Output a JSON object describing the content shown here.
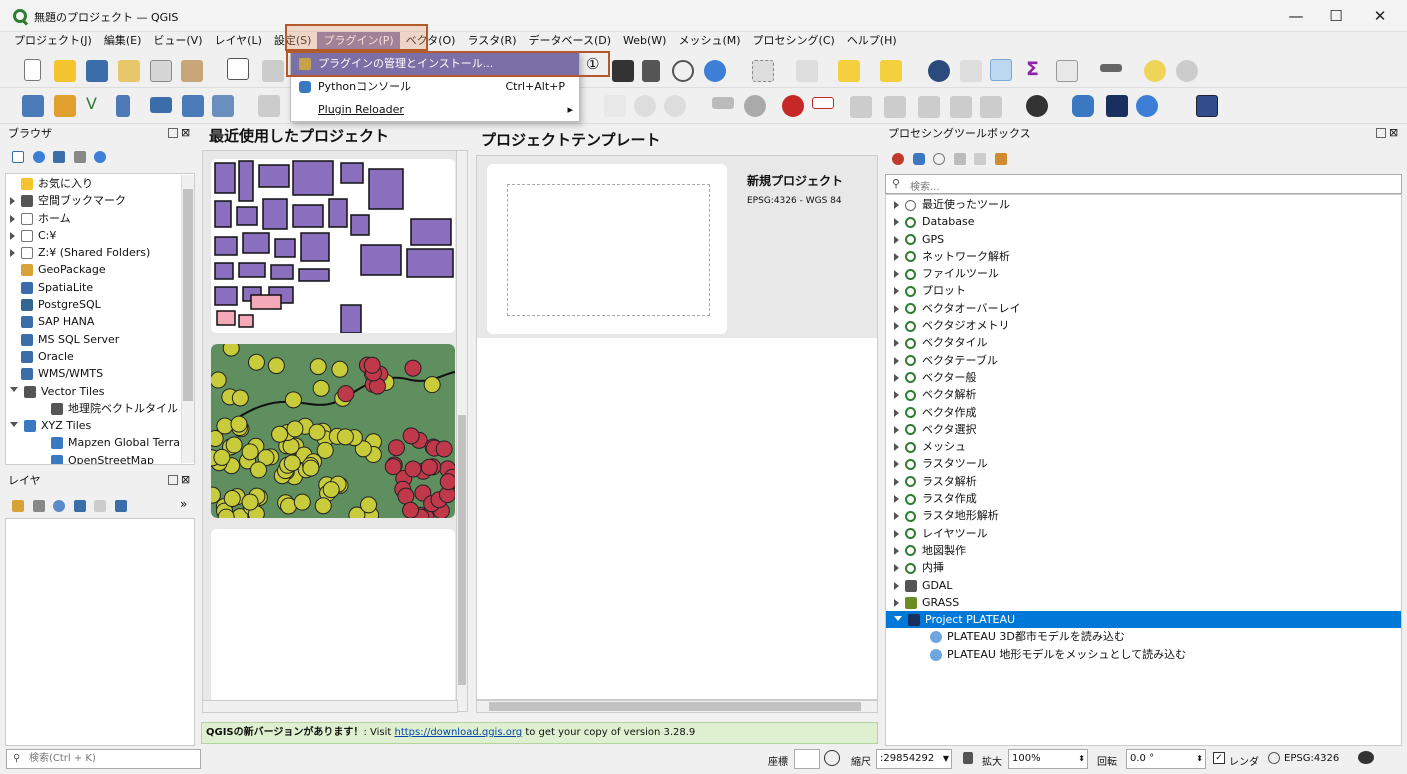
{
  "window": {
    "title": "無題のプロジェクト — QGIS",
    "minimize": "—",
    "maximize": "☐",
    "close": "✕"
  },
  "menubar": [
    "プロジェクト(J)",
    "編集(E)",
    "ビュー(V)",
    "レイヤ(L)",
    "設定(S)",
    "プラグイン(P)",
    "ベクタ(O)",
    "ラスタ(R)",
    "データベース(D)",
    "Web(W)",
    "メッシュ(M)",
    "プロセシング(C)",
    "ヘルプ(H)"
  ],
  "plugin_menu": {
    "items": [
      {
        "label": "プラグインの管理とインストール...",
        "shortcut": ""
      },
      {
        "label": "Pythonコンソール",
        "shortcut": "Ctrl+Alt+P"
      },
      {
        "label": "Plugin Reloader",
        "shortcut": "▸"
      }
    ],
    "annotation": "①"
  },
  "browser": {
    "title": "ブラウザ",
    "items": [
      {
        "label": "お気に入り",
        "expand": "",
        "icon": "star-icon"
      },
      {
        "label": "空間ブックマーク",
        "expand": "closed",
        "icon": "bookmark-icon"
      },
      {
        "label": "ホーム",
        "expand": "closed",
        "icon": "home-folder-icon"
      },
      {
        "label": "C:¥",
        "expand": "closed",
        "icon": "folder-icon"
      },
      {
        "label": "Z:¥ (Shared Folders)",
        "expand": "closed",
        "icon": "folder-icon"
      },
      {
        "label": "GeoPackage",
        "expand": "",
        "icon": "geopackage-icon"
      },
      {
        "label": "SpatiaLite",
        "expand": "",
        "icon": "spatialite-icon"
      },
      {
        "label": "PostgreSQL",
        "expand": "",
        "icon": "postgresql-icon"
      },
      {
        "label": "SAP HANA",
        "expand": "",
        "icon": "sap-hana-icon"
      },
      {
        "label": "MS SQL Server",
        "expand": "",
        "icon": "mssql-icon"
      },
      {
        "label": "Oracle",
        "expand": "",
        "icon": "oracle-icon"
      },
      {
        "label": "WMS/WMTS",
        "expand": "",
        "icon": "globe-icon"
      },
      {
        "label": "Vector Tiles",
        "expand": "open",
        "icon": "vector-tiles-icon"
      },
      {
        "label": "地理院ベクトルタイル",
        "expand": "child",
        "icon": "vector-tiles-icon"
      },
      {
        "label": "XYZ Tiles",
        "expand": "open",
        "icon": "xyz-tiles-icon"
      },
      {
        "label": "Mapzen Global Terrain",
        "expand": "child",
        "icon": "xyz-tiles-icon"
      },
      {
        "label": "OpenStreetMap",
        "expand": "child",
        "icon": "xyz-tiles-icon"
      }
    ]
  },
  "layers": {
    "title": "レイヤ",
    "more": "»"
  },
  "recent": {
    "title": "最近使用したプロジェクト"
  },
  "templates": {
    "title": "プロジェクトテンプレート",
    "new_project": "新規プロジェクト",
    "crs": "EPSG:4326 - WGS 84"
  },
  "news": {
    "prefix": "QGISの新バージョンがあります！",
    "visit": ": Visit ",
    "link": "https://download.qgis.org",
    "suffix": " to get your copy of version 3.28.9"
  },
  "processing": {
    "title": "プロセシングツールボックス",
    "search_placeholder": "検索...",
    "items": [
      {
        "label": "最近使ったツール",
        "icon": "clock-icon"
      },
      {
        "label": "Database",
        "icon": "qgis-icon"
      },
      {
        "label": "GPS",
        "icon": "qgis-icon"
      },
      {
        "label": "ネットワーク解析",
        "icon": "qgis-icon"
      },
      {
        "label": "ファイルツール",
        "icon": "qgis-icon"
      },
      {
        "label": "プロット",
        "icon": "qgis-icon"
      },
      {
        "label": "ベクタオーバーレイ",
        "icon": "qgis-icon"
      },
      {
        "label": "ベクタジオメトリ",
        "icon": "qgis-icon"
      },
      {
        "label": "ベクタタイル",
        "icon": "qgis-icon"
      },
      {
        "label": "ベクタテーブル",
        "icon": "qgis-icon"
      },
      {
        "label": "ベクター般",
        "icon": "qgis-icon"
      },
      {
        "label": "ベクタ解析",
        "icon": "qgis-icon"
      },
      {
        "label": "ベクタ作成",
        "icon": "qgis-icon"
      },
      {
        "label": "ベクタ選択",
        "icon": "qgis-icon"
      },
      {
        "label": "メッシュ",
        "icon": "qgis-icon"
      },
      {
        "label": "ラスタツール",
        "icon": "qgis-icon"
      },
      {
        "label": "ラスタ解析",
        "icon": "qgis-icon"
      },
      {
        "label": "ラスタ作成",
        "icon": "qgis-icon"
      },
      {
        "label": "ラスタ地形解析",
        "icon": "qgis-icon"
      },
      {
        "label": "レイヤツール",
        "icon": "qgis-icon"
      },
      {
        "label": "地図製作",
        "icon": "qgis-icon"
      },
      {
        "label": "内挿",
        "icon": "qgis-icon"
      },
      {
        "label": "GDAL",
        "icon": "gdal-icon"
      },
      {
        "label": "GRASS",
        "icon": "grass-icon"
      },
      {
        "label": "Project PLATEAU",
        "icon": "plateau-icon",
        "selected": true
      }
    ],
    "children": [
      "PLATEAU 3D都市モデルを読み込む",
      "PLATEAU 地形モデルをメッシュとして読み込む"
    ]
  },
  "statusbar": {
    "search_placeholder": "検索(Ctrl + K)",
    "coord_label": "座標",
    "scale_label": "縮尺",
    "scale_value": ":29854292",
    "magnify_label": "拡大",
    "magnify_value": "100%",
    "rotation_label": "回転",
    "rotation_value": "0.0 °",
    "render_label": "レンダ",
    "crs": "EPSG:4326"
  },
  "colors": {
    "highlight": "#e9a27a",
    "highlight_border": "#b45a2a",
    "selected_row": "#0078d7",
    "news_bg": "#dff0d0",
    "map_green": "#5f8f5f",
    "poly_purple": "#8a6fbf"
  }
}
